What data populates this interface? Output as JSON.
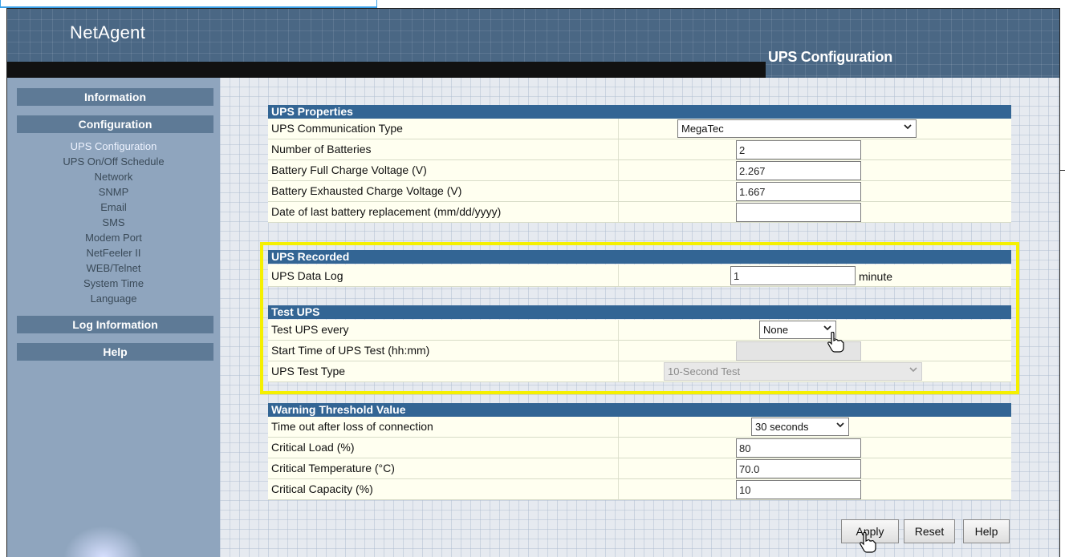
{
  "header": {
    "logo": "NetAgent",
    "page_title": "UPS Configuration"
  },
  "sidebar": {
    "information": "Information",
    "configuration": "Configuration",
    "items": [
      "UPS Configuration",
      "UPS On/Off Schedule",
      "Network",
      "SNMP",
      "Email",
      "SMS",
      "Modem Port",
      "NetFeeler II",
      "WEB/Telnet",
      "System Time",
      "Language"
    ],
    "log_information": "Log Information",
    "help": "Help"
  },
  "ups_properties": {
    "title": "UPS Properties",
    "comm_type_label": "UPS Communication Type",
    "comm_type_value": "MegaTec",
    "batteries_label": "Number of Batteries",
    "batteries_value": "2",
    "full_voltage_label": "Battery Full Charge Voltage (V)",
    "full_voltage_value": "2.267",
    "exhausted_voltage_label": "Battery Exhausted Charge Voltage (V)",
    "exhausted_voltage_value": "1.667",
    "replacement_label": "Date of last battery replacement (mm/dd/yyyy)",
    "replacement_value": ""
  },
  "ups_recorded": {
    "title": "UPS Recorded",
    "data_log_label": "UPS Data Log",
    "data_log_value": "1",
    "data_log_unit": "minute"
  },
  "test_ups": {
    "title": "Test UPS",
    "every_label": "Test UPS every",
    "every_value": "None",
    "start_time_label": "Start Time of UPS Test (hh:mm)",
    "start_time_value": "",
    "type_label": "UPS Test Type",
    "type_value": "10-Second Test"
  },
  "warning": {
    "title": "Warning Threshold Value",
    "timeout_label": "Time out after loss of connection",
    "timeout_value": "30 seconds",
    "load_label": "Critical Load (%)",
    "load_value": "80",
    "temp_label": "Critical Temperature (°C)",
    "temp_value": "70.0",
    "capacity_label": "Critical Capacity (%)",
    "capacity_value": "10"
  },
  "buttons": {
    "apply": "Apply",
    "reset": "Reset",
    "help": "Help"
  },
  "colors": {
    "section_header": "#336594",
    "highlight": "#f5f000",
    "row_bg": "#fffff0"
  },
  "icons": [
    "chevron-down-icon",
    "hand-pointer-cursor-icon"
  ]
}
